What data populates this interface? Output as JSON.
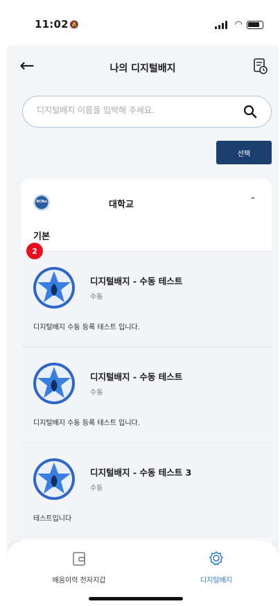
{
  "status_bar": {
    "time": "11:02"
  },
  "header": {
    "title": "나의 디지털배지"
  },
  "search": {
    "placeholder": "디지털배지 이름을 입력해 주세요."
  },
  "select_button": {
    "label": "선택"
  },
  "school": {
    "name": "대학교",
    "logo_text": "RCNu"
  },
  "section": {
    "label": "기본",
    "count": "2"
  },
  "badges": [
    {
      "name": "디지털배지 - 수동 테스트",
      "type": "수동",
      "description": "디지털배지 수동 등록 테스트 입니다."
    },
    {
      "name": "디지털배지 - 수동 테스트",
      "type": "수동",
      "description": "디지털배지 수동 등록 테스트 입니다."
    },
    {
      "name": "디지털배지 - 수동 테스트 3",
      "type": "수동",
      "description": "테스트입니다"
    }
  ],
  "bottom_nav": [
    {
      "label": "배움이력 전자지갑",
      "icon": "wallet-icon",
      "active": false
    },
    {
      "label": "디지털배지",
      "icon": "badge-icon",
      "active": true
    }
  ],
  "colors": {
    "primary": "#1b3f6e",
    "active": "#2f78d1",
    "badge_red": "#e8101c"
  }
}
